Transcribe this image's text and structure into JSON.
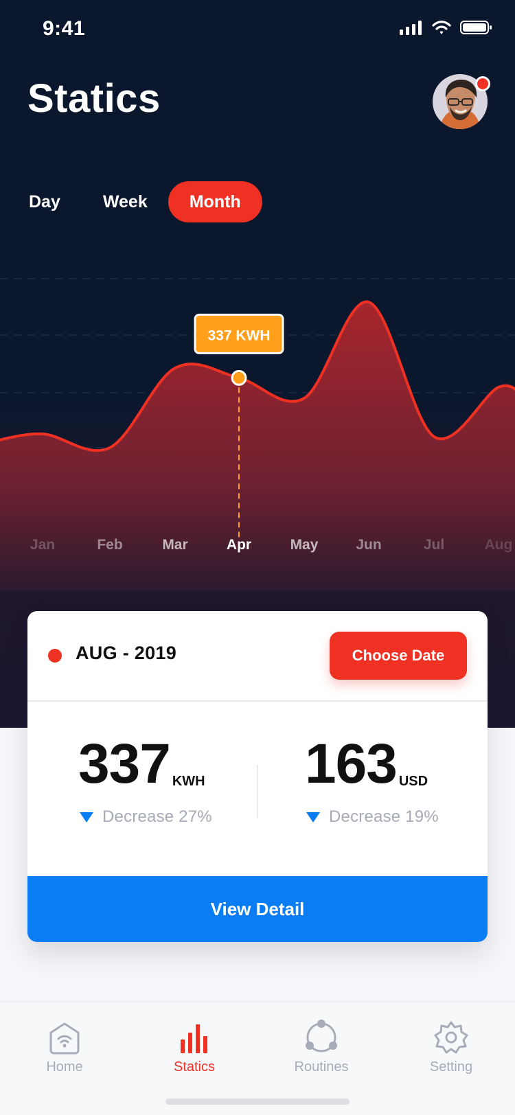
{
  "status_bar": {
    "time": "9:41",
    "icons": [
      "signal-icon",
      "wifi-icon",
      "battery-icon"
    ]
  },
  "header": {
    "title": "Statics",
    "avatar": "avatar",
    "notification_badge": "red-dot"
  },
  "period_tabs": [
    {
      "label": "Day",
      "selected": false
    },
    {
      "label": "Week",
      "selected": false
    },
    {
      "label": "Month",
      "selected": true
    }
  ],
  "chart_data": {
    "type": "area",
    "x": [
      "Jan",
      "Feb",
      "Mar",
      "Apr",
      "May",
      "Jun",
      "Jul",
      "Aug"
    ],
    "values": [
      235,
      210,
      355,
      337,
      300,
      475,
      230,
      320
    ],
    "selected_month": "Apr",
    "tooltip": "337 KWH",
    "ylim": [
      0,
      520
    ],
    "grid": true,
    "colors": {
      "line": "#ef3124",
      "fill_top": "#a6252c",
      "fill_bottom": "#3a1c2d",
      "point": "#ff9f1a",
      "grid": "#314055"
    }
  },
  "summary_card": {
    "date": "AUG - 2019",
    "choose_date_label": "Choose Date",
    "energy": {
      "value": "337",
      "unit": "KWH",
      "change": "Decrease 27%"
    },
    "cost": {
      "value": "163",
      "unit": "USD",
      "change": "Decrease 19%"
    },
    "view_detail_label": "View Detail"
  },
  "bottom_nav": [
    {
      "label": "Home",
      "icon": "home-wifi-icon",
      "selected": false
    },
    {
      "label": "Statics",
      "icon": "statistics-icon",
      "selected": true
    },
    {
      "label": "Routines",
      "icon": "routines-icon",
      "selected": false
    },
    {
      "label": "Setting",
      "icon": "settings-gear-icon",
      "selected": false
    }
  ],
  "colors": {
    "background": "#0b172d",
    "accent_red": "#ef3124",
    "accent_blue": "#0a7df4",
    "tooltip_orange": "#ff9f1a"
  }
}
